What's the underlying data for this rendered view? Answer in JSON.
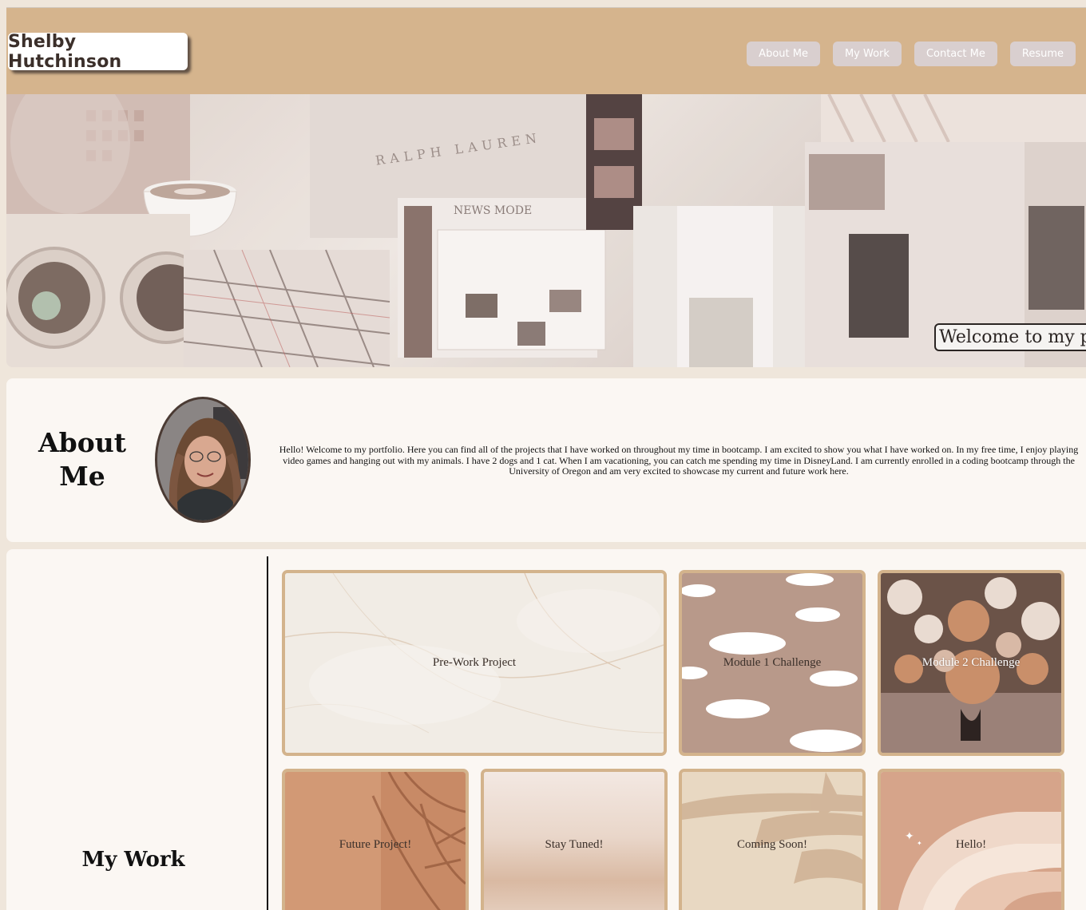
{
  "header": {
    "brand": "Shelby Hutchinson",
    "nav": [
      "About Me",
      "My Work",
      "Contact Me",
      "Resume"
    ]
  },
  "hero": {
    "welcome": "Welcome to my page",
    "collage_text": [
      "RALPH LAUREN",
      "NEWS MODE"
    ]
  },
  "about": {
    "title_line1": "About",
    "title_line2": "Me",
    "text": "Hello! Welcome to my portfolio. Here you can find all of the projects that I have worked on throughout my time in bootcamp. I am excited to show you what I have worked on. In my free time, I enjoy playing video games and hanging out with my animals. I have 2 dogs and 1 cat. When I am vacationing, you can catch me spending my time in DisneyLand. I am currently enrolled in a coding bootcamp through the University of Oregon and am very excited to showcase my current and future work here."
  },
  "work": {
    "title": "My Work",
    "cards": [
      "Pre-Work Project",
      "Module 1 Challenge",
      "Module 2 Challenge",
      "Future Project!",
      "Stay Tuned!",
      "Coming Soon!",
      "Hello!"
    ]
  },
  "colors": {
    "header_bg": "#d5b48d",
    "nav_bg": "#d9cfcf",
    "section_bg": "#fbf7f3",
    "page_bg": "#efe6db",
    "card_border": "#d3b38c"
  }
}
